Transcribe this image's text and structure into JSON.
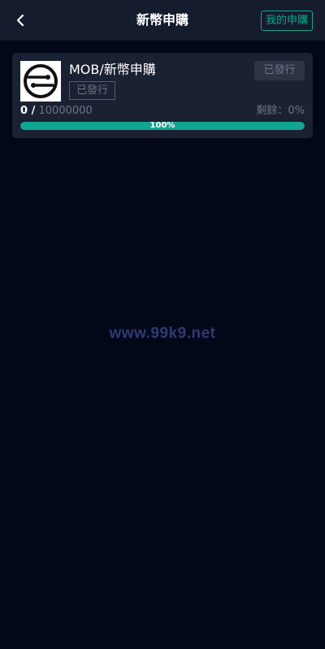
{
  "header": {
    "title": "新幣申購",
    "back_icon": "chevron-left-icon",
    "my_subscriptions_label": "我的申購"
  },
  "coin": {
    "name": "MOB/新幣申購",
    "tag": "已發行",
    "status": "已發行",
    "logo_icon": "mob-logo-icon",
    "progress": {
      "subscribed": "0 /",
      "total": "10000000",
      "remaining_label": "剩餘：0%",
      "percent_value": 100,
      "percent_label": "100%"
    }
  },
  "watermark": "www.99k9.net",
  "colors": {
    "accent": "#12a592",
    "background": "#020817",
    "card": "#1a2132",
    "header": "#151c2d",
    "muted": "#6c7587"
  }
}
